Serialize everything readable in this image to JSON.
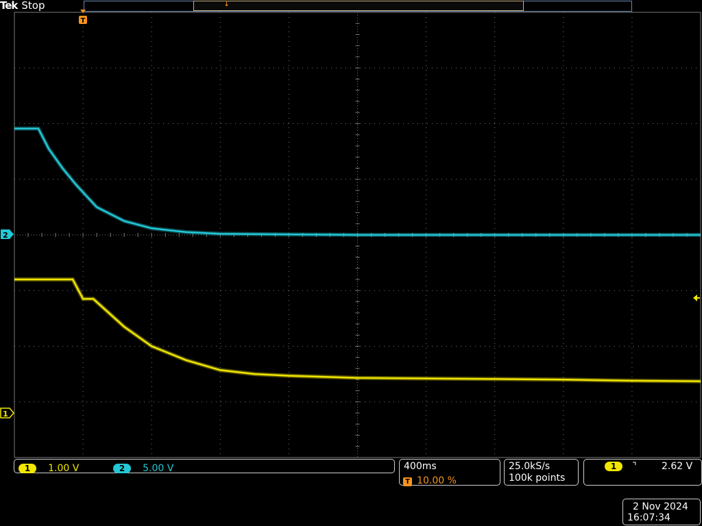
{
  "header": {
    "brand": "Tek",
    "acq_state": "Stop"
  },
  "markers": {
    "trigger_position_marker": "T",
    "expansion_point_marker": "↓",
    "ch2_ground_marker": "2",
    "ch1_ground_marker": "1"
  },
  "channels": [
    {
      "id": "1",
      "scale": "1.00 V",
      "color": "#f1e700"
    },
    {
      "id": "2",
      "scale": "5.00 V",
      "color": "#23c8d6"
    }
  ],
  "horizontal": {
    "time_per_div": "400ms",
    "trigger_marker": "T",
    "trigger_position": "10.00 %"
  },
  "acquisition": {
    "sample_rate": "25.0kS/s",
    "record_length": "100k points"
  },
  "trigger": {
    "source": "1",
    "slope_glyph": "⌝",
    "level": "2.62 V"
  },
  "datetime": {
    "date": "2 Nov 2024",
    "time": "16:07:34"
  },
  "colors": {
    "ch1": "#f1e700",
    "ch2": "#23c8d6",
    "trigger": "#f7941d",
    "graticule": "#7a7a7a"
  },
  "chart_data": {
    "type": "line",
    "title": "",
    "xlabel": "",
    "ylabel": "",
    "x_units": "divisions",
    "y_units": "divisions",
    "xlim": [
      0,
      10
    ],
    "ylim": [
      -4,
      4
    ],
    "grid": true,
    "series": [
      {
        "x": [
          0,
          0.35,
          0.5,
          0.7,
          0.9,
          1.2,
          1.6,
          2.0,
          2.5,
          3.0,
          4.0,
          5.0,
          6.0,
          7.0,
          8.0,
          9.0,
          10.0
        ],
        "y": [
          1.91,
          1.91,
          1.55,
          1.2,
          0.9,
          0.5,
          0.25,
          0.12,
          0.05,
          0.02,
          0.01,
          0.0,
          0.0,
          0.0,
          0.0,
          0.0,
          0.0
        ]
      },
      {
        "x": [
          0,
          0.85,
          1.0,
          1.15,
          1.6,
          2.0,
          2.5,
          3.0,
          3.5,
          4.0,
          5.0,
          6.0,
          7.0,
          8.0,
          9.0,
          10.0
        ],
        "y": [
          1.8,
          1.8,
          1.45,
          1.45,
          0.95,
          0.6,
          0.35,
          0.17,
          0.1,
          0.07,
          0.03,
          0.02,
          0.01,
          0.0,
          -0.02,
          -0.03
        ]
      }
    ],
    "series_offsets_div": [
      0,
      -2.6
    ]
  }
}
